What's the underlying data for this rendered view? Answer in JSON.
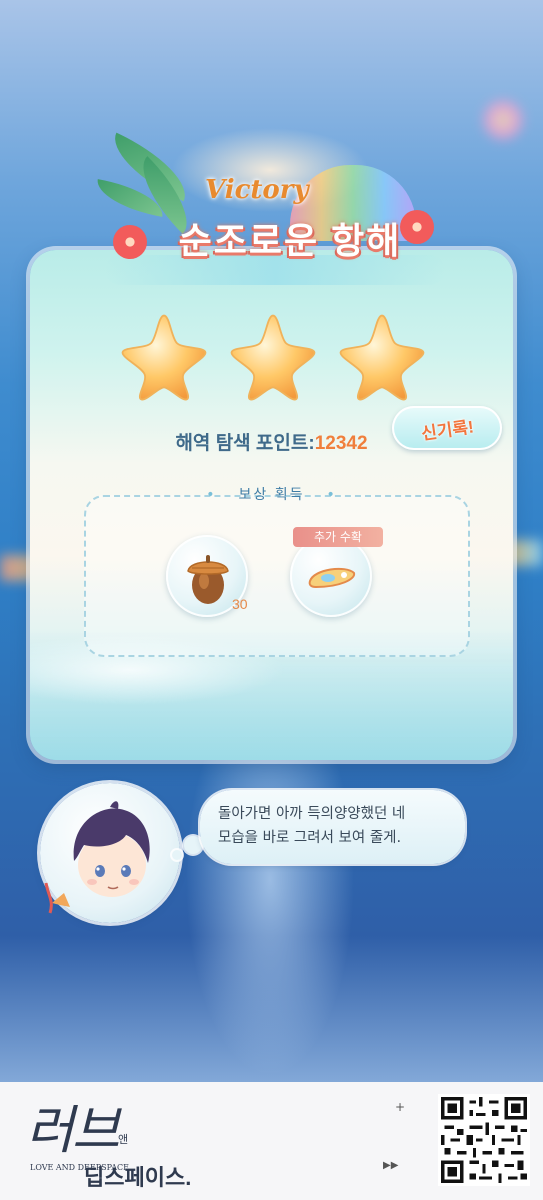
{
  "result": {
    "victory_label": "Victory",
    "title": "순조로운 항해",
    "stars_earned": 3,
    "stars_total": 3,
    "points_label": "해역 탐색 포인트:",
    "points_value": "12342",
    "new_record_label": "신기록!"
  },
  "rewards": {
    "header": "보상 획득",
    "items": [
      {
        "name": "acorn",
        "icon": "acorn-icon",
        "quantity": "30"
      },
      {
        "name": "hair-clip",
        "icon": "hair-clip-icon",
        "tag": "추가 수확"
      }
    ]
  },
  "dialog": {
    "line1": "돌아가면 아까 득의양양했던 네",
    "line2": "모습을 바로 그려서 보여 줄게."
  },
  "footer": {
    "logo_text": "러브",
    "logo_suffix": "앤",
    "logo_en": "LOVE AND DEEPSPACE",
    "logo_name": "딥스페이스.",
    "plus": "+",
    "play": "▶▶"
  },
  "colors": {
    "accent_orange": "#f07f3c",
    "points_label": "#3f6a8a",
    "title_outline": "#e97a6a"
  }
}
